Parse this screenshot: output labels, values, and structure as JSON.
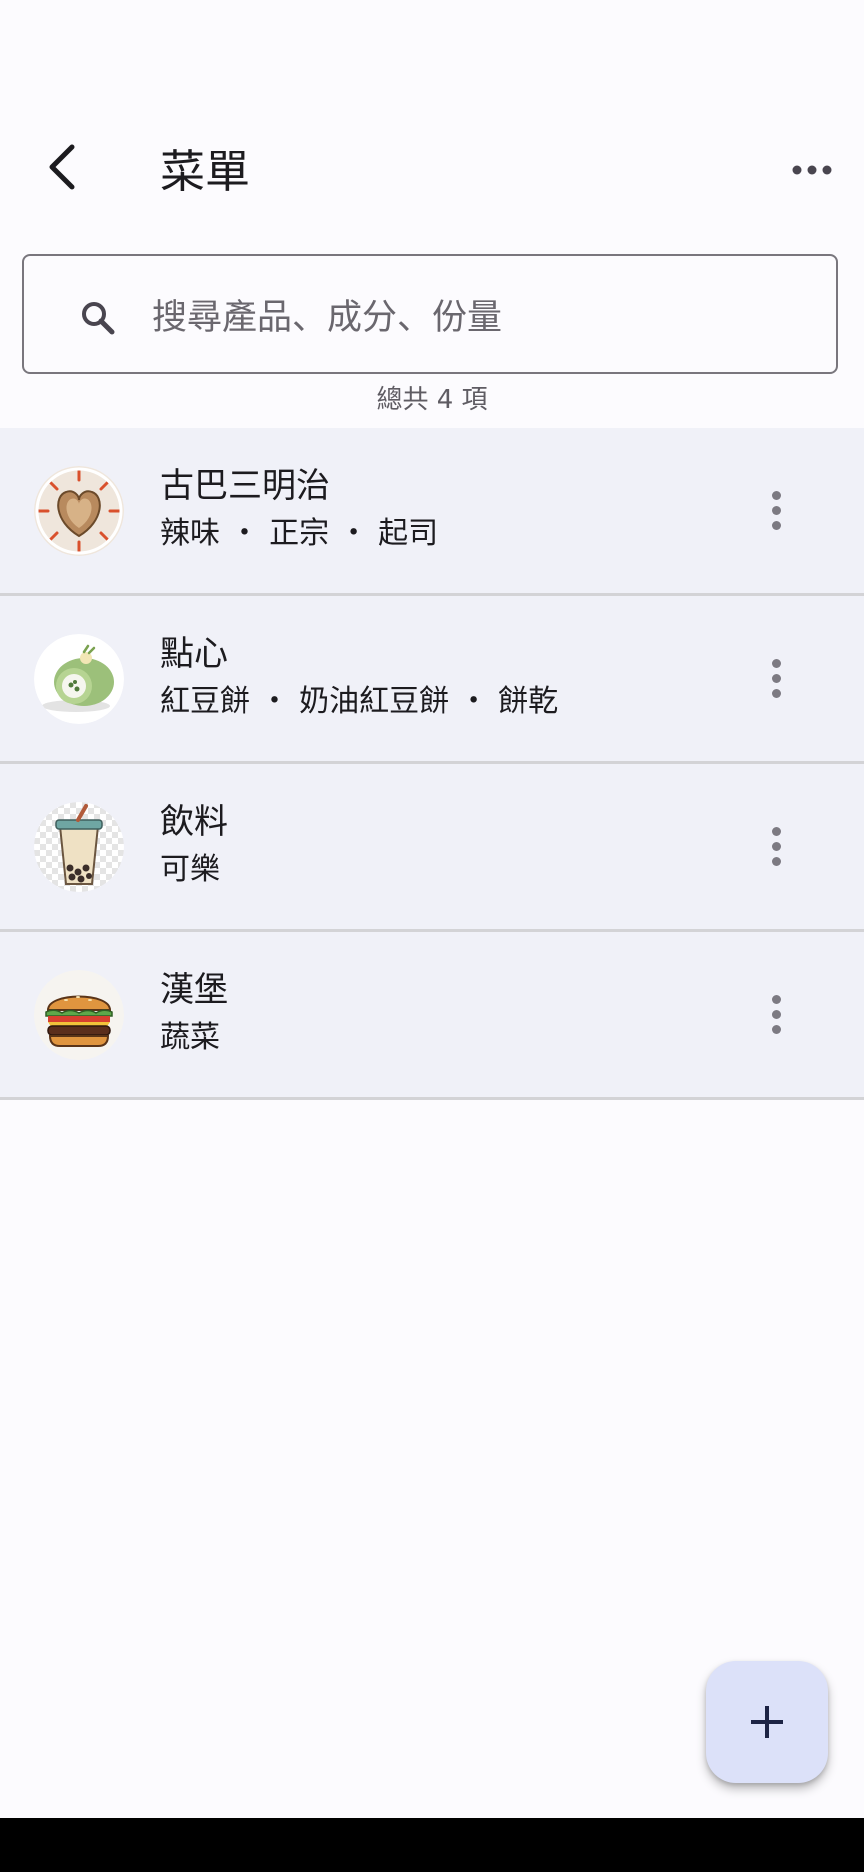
{
  "appbar": {
    "title": "菜單",
    "back_icon": "arrow-back-icon",
    "more_icon": "more-horiz-icon"
  },
  "search": {
    "placeholder": "搜尋產品、成分、份量",
    "icon": "search-icon"
  },
  "count_text": "總共 4 項",
  "items": [
    {
      "name": "古巴三明治",
      "subtitle": "辣味 ・ 正宗 ・ 起司",
      "icon": "sandwich-icon"
    },
    {
      "name": "點心",
      "subtitle": "紅豆餅 ・ 奶油紅豆餅 ・ 餅乾",
      "icon": "cake-roll-icon"
    },
    {
      "name": "飲料",
      "subtitle": "可樂",
      "icon": "bubble-tea-icon"
    },
    {
      "name": "漢堡",
      "subtitle": "蔬菜",
      "icon": "burger-icon"
    }
  ],
  "fab": {
    "icon": "add-icon"
  },
  "colors": {
    "background": "#fcfbfe",
    "row": "#f0f1f8",
    "fab": "#dce1f9"
  }
}
